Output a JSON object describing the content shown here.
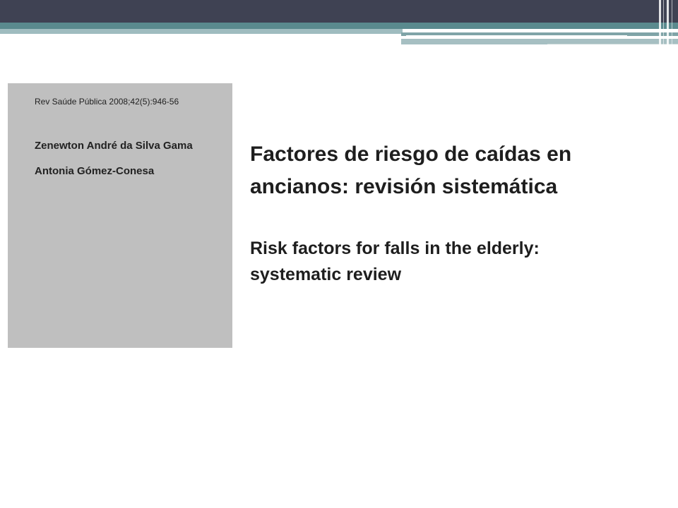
{
  "colors": {
    "header_dark": "#3f4253",
    "header_teal": "#5a8a8e",
    "header_light": "#9fbcbf",
    "panel_grey": "#bfbfbf",
    "text": "#1e1e1e"
  },
  "document": {
    "citation": "Rev Saúde Pública 2008;42(5):946-56",
    "authors": [
      "Zenewton André da Silva Gama",
      "Antonia Gómez-Conesa"
    ],
    "title_es_line1": "Factores de riesgo de caídas en",
    "title_es_line2": "ancianos: revisión sistemática",
    "title_en_line1": "Risk factors for falls in the elderly:",
    "title_en_line2": "systematic review"
  }
}
